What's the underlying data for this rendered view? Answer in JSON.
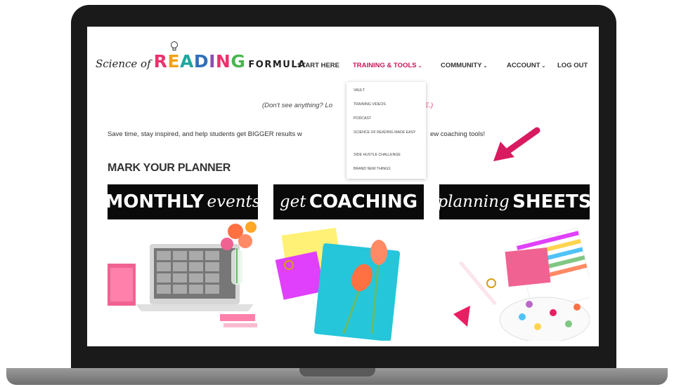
{
  "brand": {
    "logo_script": "Science of",
    "logo_letters": [
      "R",
      "E",
      "A",
      "D",
      "I",
      "N",
      "G"
    ],
    "logo_colors": [
      "#e8336d",
      "#f0a21c",
      "#1fa7a0",
      "#2f6fb8",
      "#8a4fb3",
      "#e8336d",
      "#4bb54f"
    ],
    "logo_suffix": "FORMULA"
  },
  "nav": {
    "start_here": "START HERE",
    "training_tools": "TRAINING & TOOLS",
    "community": "COMMUNITY",
    "account": "ACCOUNT",
    "log_out": "LOG OUT",
    "chevron": "⌄"
  },
  "dropdown": {
    "items": [
      "VAULT",
      "TRAINING VIDEOS",
      "PODCAST",
      "SCIENCE OF READING MADE EASY",
      "SIDE HUSTLE CHALLENGE",
      "BRAND NEW THINGS"
    ]
  },
  "notice": {
    "start": "(Don't see anything? Lo",
    "end": "E.)"
  },
  "tagline": {
    "start": "Save time, stay inspired, and help students get BIGGER results w",
    "end": "ew coaching tools!"
  },
  "section_heading": "MARK YOUR PLANNER",
  "cards": [
    {
      "script": "",
      "bold": "MONTHLY",
      "script_after": "events"
    },
    {
      "script": "get",
      "bold": "COACHING",
      "script_after": ""
    },
    {
      "script": "planning",
      "bold": "SHEETS",
      "script_after": ""
    }
  ],
  "colors": {
    "accent_pink": "#d81b60",
    "nav_active": "#c2185b",
    "banner_bg": "#0a0a0a"
  }
}
